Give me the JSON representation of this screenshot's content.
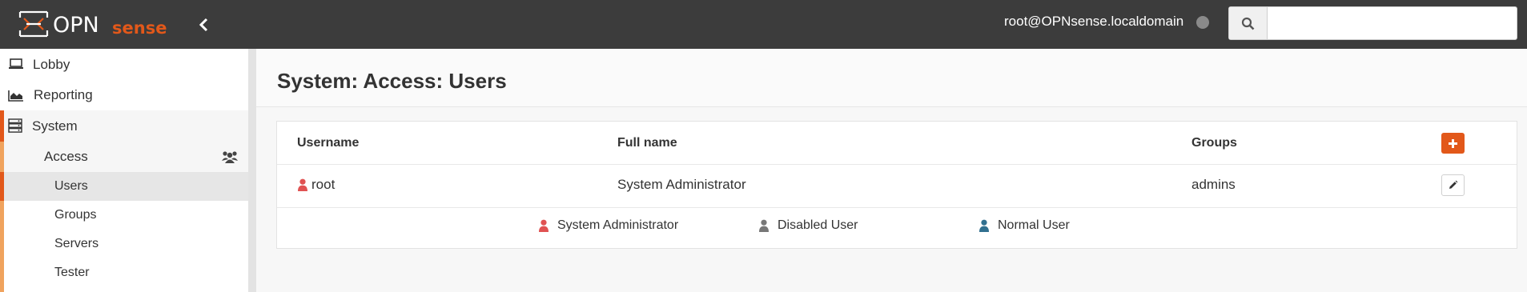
{
  "header": {
    "brand_prefix": "OPN",
    "brand_suffix": "sense",
    "user": "root@OPNsense.localdomain",
    "search": {
      "placeholder": "",
      "value": ""
    }
  },
  "sidebar": {
    "items": [
      {
        "label": "Lobby",
        "icon": "laptop-icon"
      },
      {
        "label": "Reporting",
        "icon": "area-chart-icon"
      },
      {
        "label": "System",
        "icon": "server-icon"
      }
    ],
    "system_children": [
      {
        "label": "Access",
        "icon": "users-icon"
      }
    ],
    "access_children": [
      {
        "label": "Users",
        "active": true
      },
      {
        "label": "Groups"
      },
      {
        "label": "Servers"
      },
      {
        "label": "Tester"
      }
    ]
  },
  "page": {
    "title": "System: Access: Users"
  },
  "table": {
    "columns": [
      "Username",
      "Full name",
      "Groups"
    ],
    "rows": [
      {
        "username": "root",
        "fullname": "System Administrator",
        "groups": "admins",
        "user_type": "admin"
      }
    ]
  },
  "legend": [
    {
      "label": "System Administrator",
      "color": "#e05252"
    },
    {
      "label": "Disabled User",
      "color": "#777777"
    },
    {
      "label": "Normal User",
      "color": "#31708f"
    }
  ],
  "colors": {
    "accent": "#e2581a",
    "sidebar_accent": "#f0a35e",
    "header_bg": "#3c3c3c"
  }
}
